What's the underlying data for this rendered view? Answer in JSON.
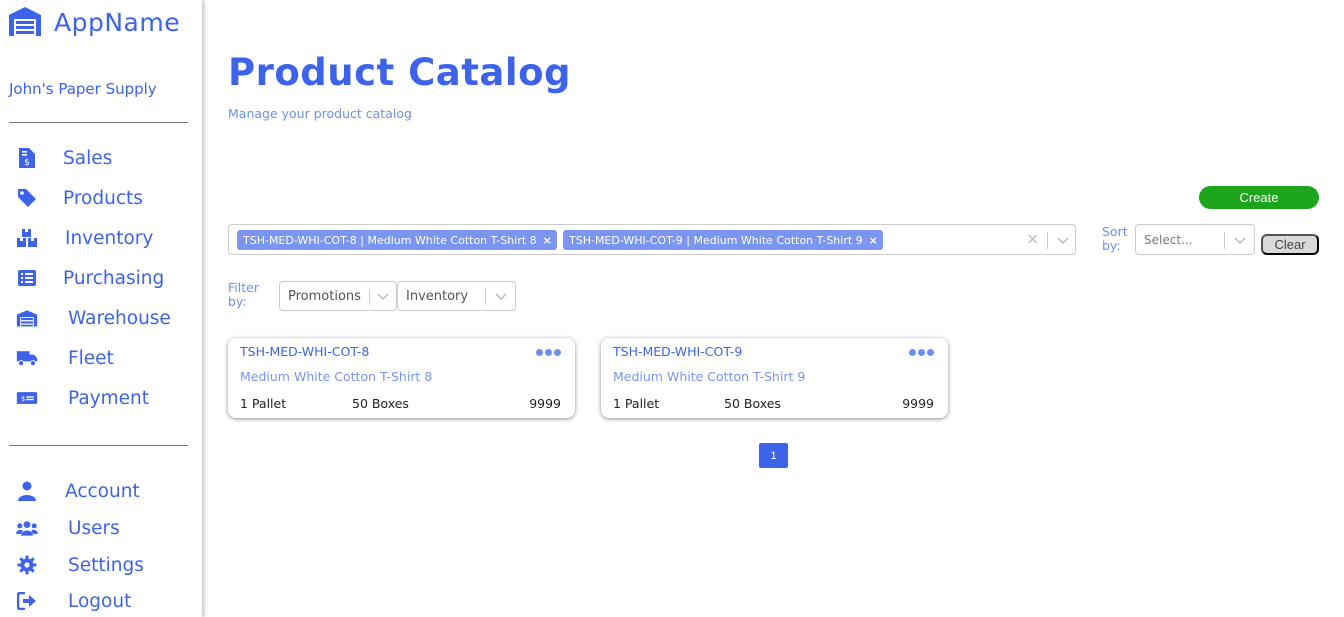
{
  "app": {
    "name": "AppName",
    "company": "John's Paper Supply"
  },
  "sidebar": {
    "main_items": [
      {
        "label": "Sales",
        "icon": "invoice-dollar-icon"
      },
      {
        "label": "Products",
        "icon": "tag-icon"
      },
      {
        "label": "Inventory",
        "icon": "boxes-icon"
      },
      {
        "label": "Purchasing",
        "icon": "list-icon"
      },
      {
        "label": "Warehouse",
        "icon": "warehouse-icon"
      },
      {
        "label": "Fleet",
        "icon": "truck-icon"
      },
      {
        "label": "Payment",
        "icon": "money-check-icon"
      }
    ],
    "bottom_items": [
      {
        "label": "Account",
        "icon": "user-icon"
      },
      {
        "label": "Users",
        "icon": "users-icon"
      },
      {
        "label": "Settings",
        "icon": "gear-icon"
      },
      {
        "label": "Logout",
        "icon": "sign-out-icon"
      }
    ]
  },
  "header": {
    "title": "Product Catalog",
    "subtitle": "Manage your product catalog"
  },
  "actions": {
    "create_label": "Create",
    "clear_label": "Clear"
  },
  "search": {
    "selected": [
      "TSH-MED-WHI-COT-8 | Medium White Cotton T-Shirt 8",
      "TSH-MED-WHI-COT-9 | Medium White Cotton T-Shirt 9"
    ],
    "clear_glyph": "×",
    "remove_glyph": "×"
  },
  "sort": {
    "label": "Sort by:",
    "placeholder": "Select..."
  },
  "filter": {
    "label": "Filter by:",
    "options": [
      "Promotions",
      "Inventory"
    ]
  },
  "products": [
    {
      "sku": "TSH-MED-WHI-COT-8",
      "name": "Medium White Cotton T-Shirt 8",
      "unit": "1 Pallet",
      "pack": "50 Boxes",
      "quantity": "9999"
    },
    {
      "sku": "TSH-MED-WHI-COT-9",
      "name": "Medium White Cotton T-Shirt 9",
      "unit": "1 Pallet",
      "pack": "50 Boxes",
      "quantity": "9999"
    }
  ],
  "pagination": {
    "current": "1"
  },
  "colors": {
    "accent": "#3d63ea",
    "accent_light": "#7b95f0",
    "create": "#1ea51e",
    "clear": "#d9d9d9"
  }
}
